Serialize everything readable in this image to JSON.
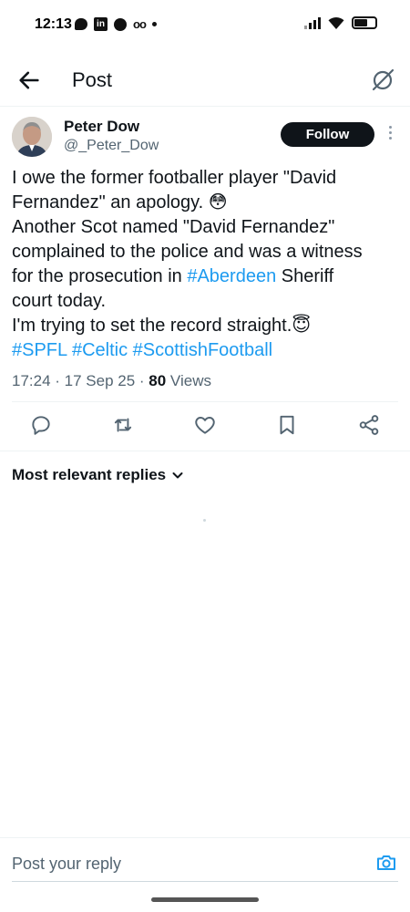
{
  "status_bar": {
    "time": "12:13",
    "linkedin_glyph": "in",
    "voicemail_glyph": "oo",
    "icons_left": [
      "message-icon",
      "linkedin-icon",
      "circle-icon",
      "voicemail-icon",
      "dot-icon"
    ],
    "icons_right": [
      "signal-icon",
      "wifi-icon",
      "battery-icon"
    ]
  },
  "header": {
    "title": "Post",
    "back_icon": "arrow-left-icon",
    "grok_icon": "grok-icon"
  },
  "post": {
    "author_name": "Peter Dow",
    "author_handle": "@_Peter_Dow",
    "follow_label": "Follow",
    "body": {
      "l1": "I owe the former footballer player \"David",
      "l2a": "Fernandez\" an apology. ",
      "l2_emoji": "😳",
      "l3": "Another Scot named \"David Fernandez\"",
      "l4": "complained to the police and was a witness",
      "l5a": "for the prosecution in ",
      "l5_tag": "#Aberdeen",
      "l5b": " Sheriff",
      "l6": "court today.",
      "l7a": "I'm trying to set the record straight.",
      "l7_emoji": "😇",
      "tag1": "#SPFL",
      "tag2": "#Celtic",
      "tag3": "#ScottishFootball"
    },
    "time": "17:24",
    "sep1": " · ",
    "date": "17 Sep 25",
    "sep2": " · ",
    "views_count": "80",
    "views_label": " Views"
  },
  "actions": [
    "reply-icon",
    "repost-icon",
    "like-icon",
    "bookmark-icon",
    "share-icon"
  ],
  "replies": {
    "filter_label": "Most relevant replies"
  },
  "reply_bar": {
    "placeholder": "Post your reply",
    "camera_icon": "camera-icon"
  },
  "colors": {
    "accent": "#1d9bf0",
    "text": "#0f1419",
    "secondary": "#536471",
    "follow_bg": "#0f1419"
  }
}
